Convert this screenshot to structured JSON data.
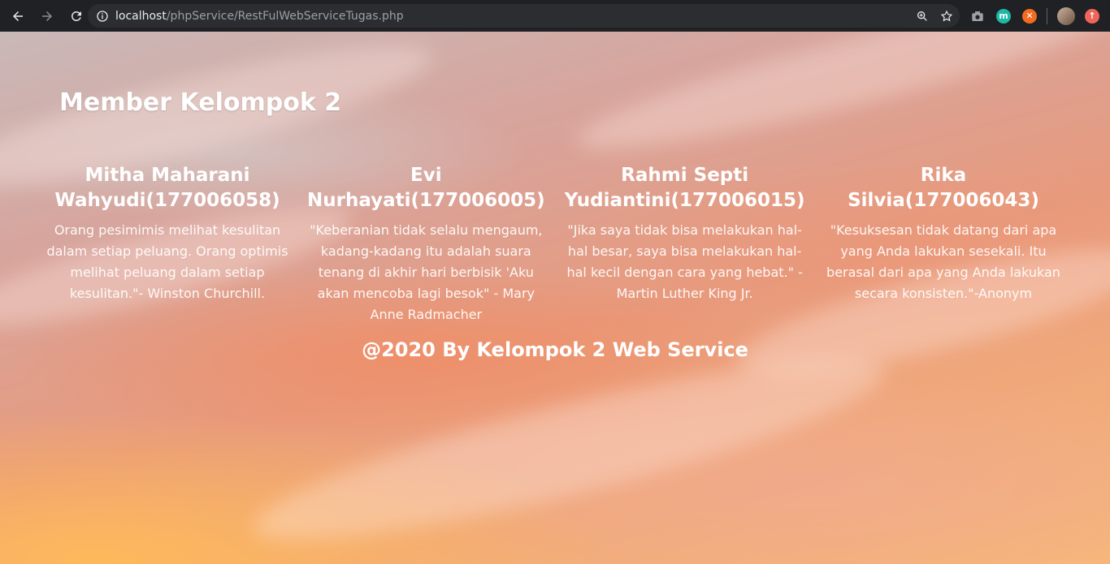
{
  "browser": {
    "url_host": "localhost",
    "url_path": "/phpService/RestFulWebServiceTugas.php",
    "extensions": [
      {
        "name": "camera-extension-icon",
        "color": "#9aa0a6"
      },
      {
        "name": "m-extension-icon",
        "label": "m",
        "color": "#1eb8a6"
      },
      {
        "name": "orange-extension-icon",
        "color": "#f26b21"
      },
      {
        "name": "profile-avatar",
        "color": "#8a7060"
      },
      {
        "name": "update-extension-icon",
        "color": "#f0655a"
      }
    ]
  },
  "page": {
    "title": "Member Kelompok 2",
    "members": [
      {
        "name": "Mitha Maharani Wahyudi(177006058)",
        "quote": "Orang pesimimis melihat kesulitan dalam setiap peluang. Orang optimis melihat peluang dalam setiap kesulitan.\"- Winston Churchill."
      },
      {
        "name": "Evi Nurhayati(177006005)",
        "quote": "\"Keberanian tidak selalu mengaum, kadang-kadang itu adalah suara tenang di akhir hari berbisik 'Aku akan mencoba lagi besok\" - Mary Anne Radmacher"
      },
      {
        "name": "Rahmi Septi Yudiantini(177006015)",
        "quote": "\"Jika saya tidak bisa melakukan hal-hal besar, saya bisa melakukan hal-hal kecil dengan cara yang hebat.\" - Martin Luther King Jr."
      },
      {
        "name": "Rika Silvia(177006043)",
        "quote": "\"Kesuksesan tidak datang dari apa yang Anda lakukan sesekali. Itu berasal dari apa yang Anda lakukan secara konsisten.\"-Anonym"
      }
    ],
    "footer": "@2020 By Kelompok 2 Web Service"
  }
}
